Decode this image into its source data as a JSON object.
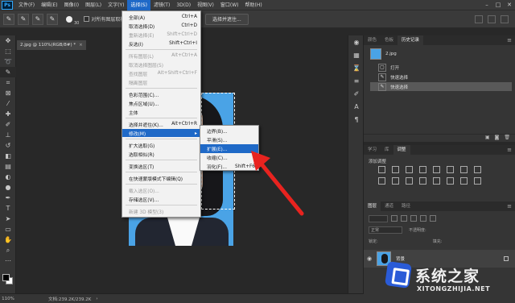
{
  "menubar": {
    "logo": "Ps",
    "items": [
      "文件(F)",
      "编辑(E)",
      "图像(I)",
      "图层(L)",
      "文字(Y)",
      "选择(S)",
      "滤镜(T)",
      "3D(D)",
      "视图(V)",
      "窗口(W)",
      "帮助(H)"
    ],
    "active_index": 5
  },
  "optionsbar": {
    "brush_size": "30",
    "sample_all_label": "对所有图层取样",
    "select_and_mask_label": "选择并遮住..."
  },
  "document": {
    "tab_title": "2.jpg @ 110%(RGB/8#) *"
  },
  "statusbar": {
    "zoom": "110%",
    "doc_info": "文档:239.2K/239.2K"
  },
  "select_menu": {
    "items": [
      {
        "label": "全部(A)",
        "shortcut": "Ctrl+A",
        "disabled": false
      },
      {
        "label": "取消选择(D)",
        "shortcut": "Ctrl+D",
        "disabled": false
      },
      {
        "label": "重新选择(E)",
        "shortcut": "Shift+Ctrl+D",
        "disabled": true
      },
      {
        "label": "反选(I)",
        "shortcut": "Shift+Ctrl+I",
        "disabled": false
      },
      {
        "label": "所有图层(L)",
        "shortcut": "Alt+Ctrl+A",
        "disabled": true
      },
      {
        "label": "取消选择图层(S)",
        "shortcut": "",
        "disabled": true
      },
      {
        "label": "查找图层",
        "shortcut": "Alt+Shift+Ctrl+F",
        "disabled": true
      },
      {
        "label": "隔离图层",
        "shortcut": "",
        "disabled": true
      },
      {
        "label": "色彩范围(C)...",
        "shortcut": "",
        "disabled": false
      },
      {
        "label": "焦点区域(U)...",
        "shortcut": "",
        "disabled": false
      },
      {
        "label": "主体",
        "shortcut": "",
        "disabled": false
      },
      {
        "label": "选择并遮住(K)...",
        "shortcut": "Alt+Ctrl+R",
        "disabled": false
      },
      {
        "label": "修改(M)",
        "shortcut": "",
        "disabled": false,
        "highlighted": true,
        "has_submenu": true
      },
      {
        "label": "扩大选取(G)",
        "shortcut": "",
        "disabled": false
      },
      {
        "label": "选取相似(R)",
        "shortcut": "",
        "disabled": false
      },
      {
        "label": "变换选区(T)",
        "shortcut": "",
        "disabled": false
      },
      {
        "label": "在快速蒙版模式下编辑(Q)",
        "shortcut": "",
        "disabled": false
      },
      {
        "label": "载入选区(O)...",
        "shortcut": "",
        "disabled": true
      },
      {
        "label": "存储选区(V)...",
        "shortcut": "",
        "disabled": false
      },
      {
        "label": "新建 3D 模型(3)",
        "shortcut": "",
        "disabled": true
      }
    ]
  },
  "modify_submenu": {
    "items": [
      {
        "label": "边界(B)...",
        "shortcut": ""
      },
      {
        "label": "平滑(S)...",
        "shortcut": ""
      },
      {
        "label": "扩展(E)...",
        "shortcut": "",
        "highlighted": true
      },
      {
        "label": "收缩(C)...",
        "shortcut": ""
      },
      {
        "label": "羽化(F)...",
        "shortcut": "Shift+F6"
      }
    ]
  },
  "history_panel": {
    "tabs": [
      "颜色",
      "色板",
      "历史记录"
    ],
    "active_tab": 2,
    "snapshot_name": "2.jpg",
    "states": [
      "打开",
      "快速选择",
      "快速选择"
    ]
  },
  "adjust_panel": {
    "tabs": [
      "学习",
      "库",
      "调整"
    ],
    "active_tab": 2,
    "title": "添加调整"
  },
  "layers_panel": {
    "tabs": [
      "图层",
      "通道",
      "路径"
    ],
    "active_tab": 0,
    "kind_label": "",
    "blend_mode": "正常",
    "opacity_label": "不透明度:",
    "lock_label": "锁定:",
    "fill_label": "填充:",
    "layer_name": "背景"
  },
  "watermark": {
    "title": "系统之家",
    "url": "XITONGZHIJIA.NET"
  },
  "colors": {
    "menu_highlight": "#1f69c7",
    "arrow_red": "#e8231f"
  }
}
